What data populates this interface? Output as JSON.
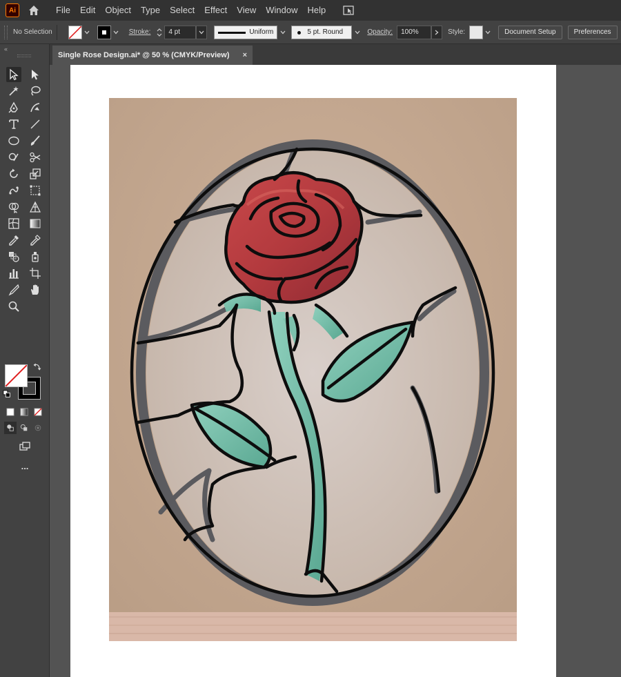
{
  "app": {
    "logo": "Ai"
  },
  "menu": [
    "File",
    "Edit",
    "Object",
    "Type",
    "Select",
    "Effect",
    "View",
    "Window",
    "Help"
  ],
  "control_bar": {
    "selection": "No Selection",
    "stroke_label": "Stroke:",
    "stroke_weight": "4 pt",
    "profile": "Uniform",
    "brush": "5 pt. Round",
    "opacity_label": "Opacity:",
    "opacity_value": "100%",
    "style_label": "Style:",
    "document_setup": "Document Setup",
    "preferences": "Preferences"
  },
  "document": {
    "tab_title": "Single Rose Design.ai* @ 50 % (CMYK/Preview)",
    "close": "×"
  },
  "toolbar": {
    "collapse": "«",
    "more": "..."
  },
  "colors": {
    "chrome_dark": "#323232",
    "panel": "#424242",
    "canvas": "#535353",
    "cardboard": "#c5a88f",
    "rose_red": "#b83a3e",
    "leaf_green": "#6fb8a3",
    "lead_line": "#111111"
  }
}
